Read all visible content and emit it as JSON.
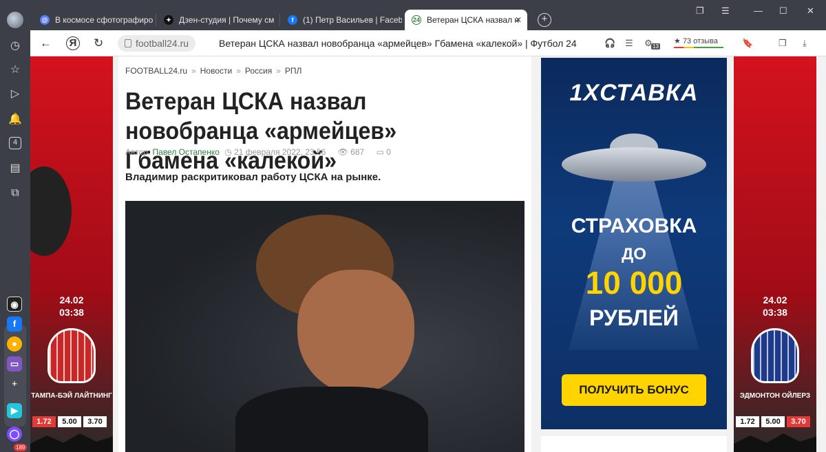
{
  "browser": {
    "tabs": [
      {
        "title": "В космосе сфотографиро",
        "icon": "at-icon",
        "active": false
      },
      {
        "title": "Дзен-студия | Почему см",
        "icon": "zen-icon",
        "active": false
      },
      {
        "title": "(1) Петр Васильев | Facebo",
        "icon": "facebook-icon",
        "active": false
      },
      {
        "title": "Ветеран ЦСКА назвал н",
        "icon": "football24-icon",
        "active": true,
        "icon_text": "24"
      }
    ],
    "new_tab": "+",
    "domain": "football24.ru",
    "page_title": "Ветеран ЦСКА назвал новобранца «армейцев» Гбамена «калекой» | Футбол 24",
    "reviews_label": "73 отзыва",
    "ya_label": "Я",
    "sidebar_badge": "189",
    "reader_count": "13",
    "sidebar_counter": "4"
  },
  "article": {
    "breadcrumbs": [
      "FOOTBALL24.ru",
      "Новости",
      "Россия",
      "РПЛ"
    ],
    "breadcrumb_sep": "»",
    "headline": "Ветеран ЦСКА назвал новобранца «армейцев» Гбамена «калекой»",
    "author_prefix": "Автор:",
    "author": "Павел Остапенко",
    "date": "21 февраля 2022, 23:56",
    "views": "687",
    "comments": "0",
    "lead": "Владимир раскритиковал работу ЦСКА на рынке."
  },
  "ads": {
    "left": {
      "date": "24.02",
      "time": "03:38",
      "team": "ТАМПА-БЭЙ ЛАЙТНИНГ",
      "odds": [
        "1.72",
        "5.00",
        "3.70"
      ]
    },
    "right": {
      "date": "24.02",
      "time": "03:38",
      "team": "ЭДМОНТОН ОЙЛЕРЗ",
      "odds": [
        "1.72",
        "5.00",
        "3.70"
      ]
    },
    "center": {
      "logo": "1XСТАВКА",
      "line1": "СТРАХОВКА",
      "line2": "ДО",
      "amount": "10 000",
      "line3": "РУБЛЕЙ",
      "button": "ПОЛУЧИТЬ БОНУС"
    }
  },
  "colors": {
    "accent_green": "#2f7d3f",
    "ad_red": "#d4121e",
    "ad_blue": "#0e3a7a",
    "bonus_yellow": "#ffd400"
  }
}
